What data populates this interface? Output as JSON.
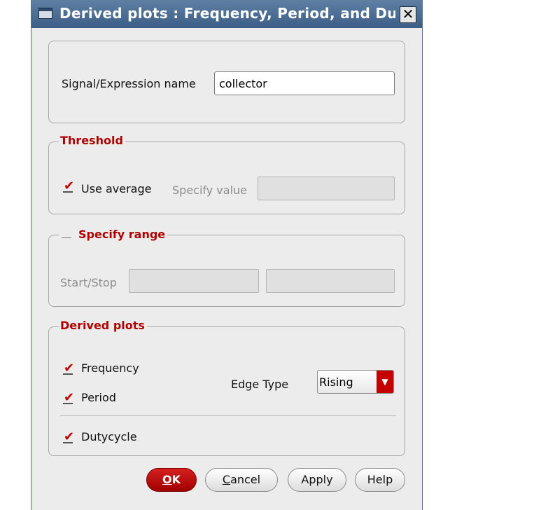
{
  "window": {
    "title": "Derived plots : Frequency, Period, and Duty",
    "close_glyph": "✕"
  },
  "signal": {
    "label": "Signal/Expression name",
    "value": "collector"
  },
  "threshold": {
    "title": "Threshold",
    "use_average_label": "Use average",
    "use_average_checked": true,
    "specify_value_label": "Specify value",
    "specify_value": ""
  },
  "range": {
    "title": "Specify range",
    "checked": false,
    "start_stop_label": "Start/Stop",
    "start": "",
    "stop": ""
  },
  "derived": {
    "title": "Derived plots",
    "frequency_label": "Frequency",
    "frequency_checked": true,
    "period_label": "Period",
    "period_checked": true,
    "edge_type_label": "Edge Type",
    "edge_type_value": "Rising",
    "dutycycle_label": "Dutycycle",
    "dutycycle_checked": true
  },
  "buttons": {
    "ok_mnemonic": "O",
    "ok_rest": "K",
    "cancel_mnemonic": "C",
    "cancel_rest": "ancel",
    "apply": "Apply",
    "help": "Help"
  },
  "colors": {
    "accent_red": "#c00000",
    "titlebar": "#4a6b92"
  },
  "icons": {
    "window_icon": "window-menu-icon",
    "close": "close-icon",
    "dropdown": "dropdown-arrow-icon",
    "check": "checkmark-icon"
  }
}
